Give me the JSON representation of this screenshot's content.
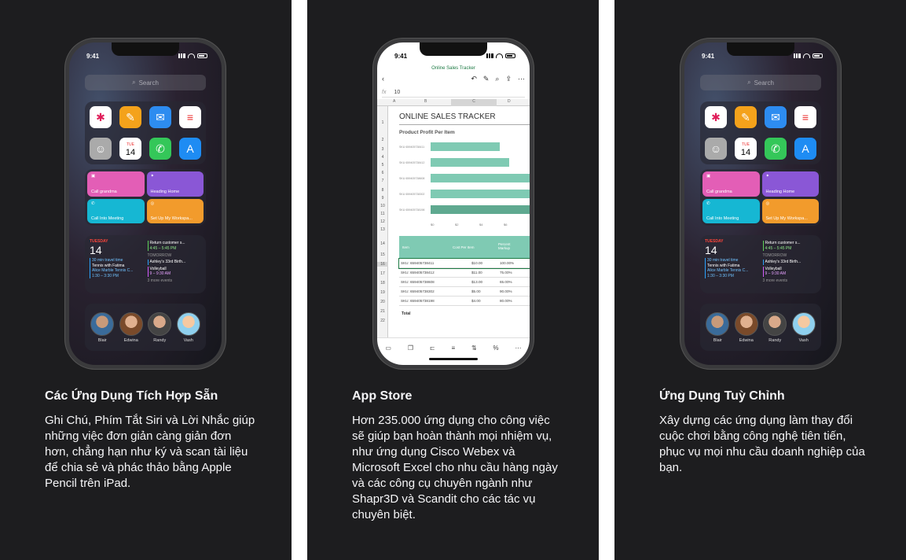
{
  "cards": [
    {
      "title": "Các Ứng Dụng Tích Hợp Sẵn",
      "description": "Ghi Chú, Phím Tắt Siri và Lời Nhắc giúp những việc đơn giản càng giản đơn hơn, chẳng hạn như ký và scan tài liệu để chia sẻ và phác thảo bằng Apple Pencil trên iPad."
    },
    {
      "title": "App Store",
      "description": "Hơn 235.000 ứng dụng cho công việc sẽ giúp bạn hoàn thành mọi nhiệm vụ, như ứng dụng Cisco Webex và Microsoft Excel cho nhu cầu hàng ngày và các công cụ chuyên ngành như Shapr3D và Scandit cho các tác vụ chuyên biệt."
    },
    {
      "title": "Ứng Dụng Tuỳ Chỉnh",
      "description": "Xây dựng các ứng dụng làm thay đổi cuộc chơi bằng công nghệ tiên tiến, phục vụ mọi nhu cầu doanh nghiệp của bạn."
    }
  ],
  "phone_home": {
    "time": "9:41",
    "search_placeholder": "Search",
    "calendar_day": "TUE",
    "calendar_date": "14",
    "shortcuts": [
      "Call grandma",
      "Heading Home",
      "Call Into Meeting",
      "Set Up My Workspa..."
    ],
    "cal_widget": {
      "day": "TUESDAY",
      "date": "14",
      "ev1_time": "30 min travel time",
      "ev1_title": "Tennis with Fatima",
      "ev1_place": "Alice Marble Tennis C...",
      "ev1_hours": "1:30 – 3:30 PM",
      "ev2_title": "Return customer s...",
      "ev2_hours": "4:45 – 5:45 PM",
      "tomorrow": "TOMORROW",
      "ev3_title": "Ashley's 33rd Birth...",
      "ev4_title": "Volleyball",
      "ev4_hours": "9 – 9:30 AM",
      "more": "3 more events"
    },
    "people": [
      "Blair",
      "Edwina",
      "Randy",
      "Vash"
    ]
  },
  "phone_excel": {
    "time": "9:41",
    "doc_title": "Online Sales Tracker",
    "fx_value": "10",
    "columns": [
      "A",
      "B",
      "C",
      "D"
    ],
    "rows": [
      "1",
      "2",
      "3",
      "4",
      "5",
      "6",
      "7",
      "8",
      "9",
      "10",
      "11",
      "12",
      "13",
      "14",
      "15",
      "16",
      "17",
      "18",
      "19",
      "20",
      "21",
      "22"
    ],
    "sheet_title": "ONLINE SALES TRACKER",
    "chart_title": "Product Profit Per Item",
    "skus": [
      "SKU 659405738411",
      "SKU 659405738412",
      "SKU 659405738608",
      "SKU 659405738302",
      "SKU 659405738198"
    ],
    "ticks": [
      "$0",
      "$2",
      "$4",
      "$6"
    ],
    "table_headers": [
      "Item",
      "Cost Per Item",
      "Percent Markup"
    ],
    "table_rows": [
      [
        "SKU: 659405738411",
        "$10.00",
        "100.00%"
      ],
      [
        "SKU: 659405738412",
        "$11.00",
        "75.00%"
      ],
      [
        "SKU: 659405738608",
        "$13.00",
        "65.00%"
      ],
      [
        "SKU: 659405738302",
        "$5.00",
        "90.00%"
      ],
      [
        "SKU: 659405738198",
        "$4.00",
        "80.00%"
      ]
    ],
    "total": "Total"
  },
  "colors": {
    "card_bg": "#1d1d1f",
    "excel_green": "#1d7a44",
    "bar": "#7fcab3"
  }
}
